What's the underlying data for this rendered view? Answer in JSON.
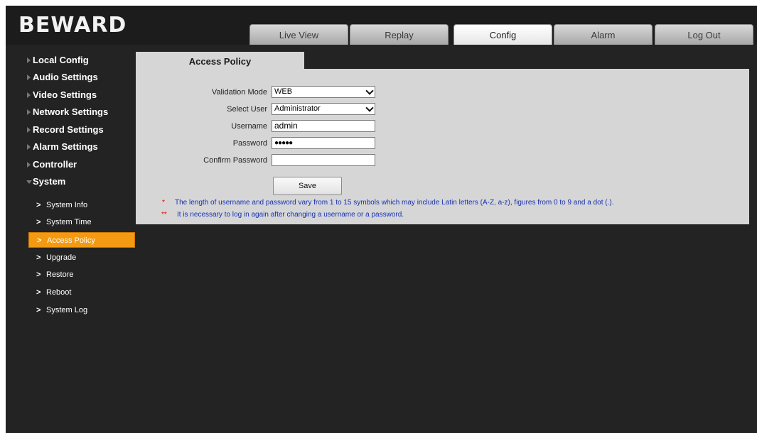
{
  "brand": {
    "logo_text": "BEWARD"
  },
  "nav": {
    "tabs": [
      {
        "label": "Live View",
        "active": false
      },
      {
        "label": "Replay",
        "active": false
      },
      {
        "label": "Config",
        "active": true
      },
      {
        "label": "Alarm",
        "active": false
      },
      {
        "label": "Log Out",
        "active": false
      }
    ]
  },
  "sidebar": {
    "sections": [
      {
        "label": "Local Config",
        "expanded": false
      },
      {
        "label": "Audio Settings",
        "expanded": false
      },
      {
        "label": "Video Settings",
        "expanded": false
      },
      {
        "label": "Network Settings",
        "expanded": false
      },
      {
        "label": "Record Settings",
        "expanded": false
      },
      {
        "label": "Alarm Settings",
        "expanded": false
      },
      {
        "label": "Controller",
        "expanded": false
      },
      {
        "label": "System",
        "expanded": true
      }
    ],
    "chevron": ">",
    "system_items": [
      {
        "label": "System Info",
        "active": false
      },
      {
        "label": "System Time",
        "active": false
      },
      {
        "label": "Access Policy",
        "active": true
      },
      {
        "label": "Upgrade",
        "active": false
      },
      {
        "label": "Restore",
        "active": false
      },
      {
        "label": "Reboot",
        "active": false
      },
      {
        "label": "System Log",
        "active": false
      }
    ]
  },
  "content": {
    "tab_title": "Access Policy",
    "form": {
      "validation_mode": {
        "label": "Validation Mode",
        "value": "WEB"
      },
      "select_user": {
        "label": "Select User",
        "value": "Administrator"
      },
      "username": {
        "label": "Username",
        "value": "admin"
      },
      "password": {
        "label": "Password",
        "value": "●●●●●"
      },
      "confirm_password": {
        "label": "Confirm Password",
        "value": ""
      }
    },
    "save_label": "Save",
    "notes": [
      {
        "mark": "*",
        "text": "The length of username and password vary from 1 to 15 symbols which may include Latin letters (A-Z, a-z), figures from 0 to 9 and a dot (.)."
      },
      {
        "mark": "**",
        "text": "It is necessary to log in again after changing a username or a password."
      }
    ]
  },
  "colors": {
    "background": "#232323",
    "panel": "#d6d6d6",
    "active_item": "#f49a12",
    "note_text": "#1632b8",
    "note_mark": "#e00000"
  }
}
